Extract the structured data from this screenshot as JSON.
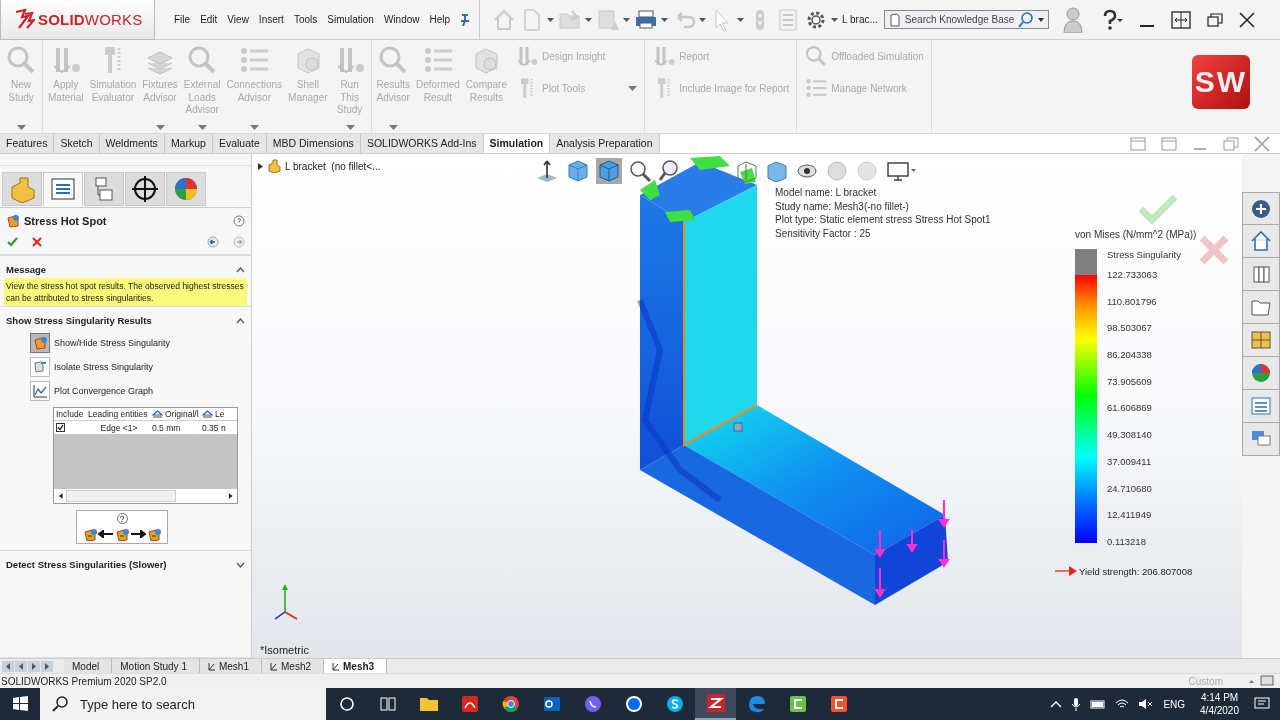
{
  "logo": "**SOLID**WORKS",
  "menu": [
    "File",
    "Edit",
    "View",
    "Insert",
    "Tools",
    "Simulation",
    "Window",
    "Help"
  ],
  "document_title": "L brac...",
  "search": {
    "placeholder": "Search Knowledge Base"
  },
  "ribbon": {
    "groups": [
      {
        "items": [
          {
            "kind": "large",
            "label": "New Study",
            "dropdown": true
          }
        ]
      },
      {
        "items": [
          {
            "kind": "large",
            "label": "Apply Material",
            "dropdown": false
          },
          {
            "kind": "large",
            "label": "Simulation Evaluator",
            "dropdown": false
          },
          {
            "kind": "large",
            "label": "Fixtures Advisor",
            "dropdown": true
          },
          {
            "kind": "large",
            "label": "External Loads Advisor",
            "dropdown": true
          },
          {
            "kind": "large",
            "label": "Connections Advisor",
            "dropdown": true
          },
          {
            "kind": "large",
            "label": "Shell Manager",
            "dropdown": false
          },
          {
            "kind": "large",
            "label": "Run This Study",
            "dropdown": true
          }
        ]
      },
      {
        "items": [
          {
            "kind": "large",
            "label": "Results Advisor",
            "dropdown": true
          },
          {
            "kind": "large",
            "label": "Deformed Result",
            "dropdown": false
          },
          {
            "kind": "large",
            "label": "Compare Results",
            "dropdown": false
          },
          {
            "kind": "small",
            "label": "Design Insight",
            "dropdown": false
          },
          {
            "kind": "small",
            "label": "Plot Tools",
            "dropdown": true
          }
        ]
      },
      {
        "items": [
          {
            "kind": "small",
            "label": "Report",
            "dropdown": false
          },
          {
            "kind": "small",
            "label": "Include Image for Report",
            "dropdown": false
          }
        ]
      },
      {
        "items": [
          {
            "kind": "small",
            "label": "Offloaded Simulation",
            "dropdown": false
          },
          {
            "kind": "small",
            "label": "Manage Network",
            "dropdown": false
          }
        ]
      }
    ]
  },
  "brand_badge": "SW",
  "command_tabs": [
    {
      "label": "Features",
      "selected": false
    },
    {
      "label": "Sketch",
      "selected": false
    },
    {
      "label": "Weldments",
      "selected": false
    },
    {
      "label": "Markup",
      "selected": false
    },
    {
      "label": "Evaluate",
      "selected": false
    },
    {
      "label": "MBD Dimensions",
      "selected": false
    },
    {
      "label": "SOLIDWORKS Add-Ins",
      "selected": false
    },
    {
      "label": "Simulation",
      "selected": true
    },
    {
      "label": "Analysis Preparation",
      "selected": false
    }
  ],
  "panel_tabs": [
    {
      "kind": "part",
      "selected": false
    },
    {
      "kind": "property",
      "selected": true
    },
    {
      "kind": "config",
      "selected": false
    },
    {
      "kind": "target",
      "selected": false
    },
    {
      "kind": "appearance",
      "selected": false
    }
  ],
  "panel_title": "Stress Hot Spot",
  "message_section": {
    "title": "Message",
    "expanded": true,
    "text": "View the stress hot spot results. The observed highest stresses can be attributed to stress singularities."
  },
  "results_section": {
    "title": "Show Stress Singularity Results",
    "expanded": true,
    "actions": [
      {
        "label": "Show/Hide Stress Singularity",
        "selected": true
      },
      {
        "label": "Isolate Stress Singularity",
        "selected": false
      },
      {
        "label": "Plot Convergence Graph",
        "selected": false
      }
    ],
    "table": {
      "columns": [
        "Include",
        "Leading entities",
        "Original/l",
        "Le"
      ],
      "rows": [
        {
          "cells": [
            {
              "kind": "checkbox",
              "checked": true
            },
            {
              "kind": "text",
              "text": "Edge <1>"
            },
            {
              "kind": "text",
              "text": "0.5 mm"
            },
            {
              "kind": "text",
              "text": "0.35 n"
            }
          ]
        }
      ]
    },
    "nav_help": "?"
  },
  "detect_section": {
    "title": "Detect Stress Singularities (Slower)",
    "expanded": false
  },
  "viewport": {
    "tree_item": "L bracket  (no fillet<...",
    "info": [
      "Model name: L bracket",
      "Study name: Mesh3(-no fillet-)",
      "Plot type: Static element stress Stress Hot Spot1",
      "Sensitivity Factor : 25"
    ],
    "legend": {
      "title": "von Mises (N/mm^2 (MPa))",
      "singularity": "Stress Singularity",
      "values": [
        "122.733063",
        "110.801796",
        "98.503067",
        "86.204338",
        "73.905609",
        "61.606869",
        "49.308140",
        "37.009411",
        "24.710680",
        "12.411949",
        "0.113218"
      ],
      "yield": "Yield strength: 206.807008"
    },
    "view_name": "*Isometric"
  },
  "bottom_tabs": [
    {
      "label": "Model",
      "kind": "model",
      "selected": false
    },
    {
      "label": "Motion Study 1",
      "kind": "motion",
      "selected": false
    },
    {
      "label": "Mesh1",
      "kind": "study",
      "selected": false
    },
    {
      "label": "Mesh2",
      "kind": "study",
      "selected": false
    },
    {
      "label": "Mesh3",
      "kind": "study",
      "selected": true
    }
  ],
  "status": {
    "product": "SOLIDWORKS Premium 2020 SP2.0",
    "units": "Custom"
  },
  "taskbar": {
    "search_placeholder": "Type here to search",
    "apps": [
      {
        "kind": "explorer",
        "active": false
      },
      {
        "kind": "pdf",
        "active": false
      },
      {
        "kind": "chrome",
        "active": false
      },
      {
        "kind": "outlook",
        "active": false
      },
      {
        "kind": "viber",
        "active": false
      },
      {
        "kind": "chat",
        "active": false
      },
      {
        "kind": "skype",
        "active": false
      },
      {
        "kind": "solidworks",
        "active": true
      },
      {
        "kind": "edge",
        "active": false
      },
      {
        "kind": "camtasia",
        "active": false
      },
      {
        "kind": "recorder",
        "active": false
      }
    ],
    "language": "ENG",
    "time": "4:14 PM",
    "date": "4/4/2020"
  }
}
